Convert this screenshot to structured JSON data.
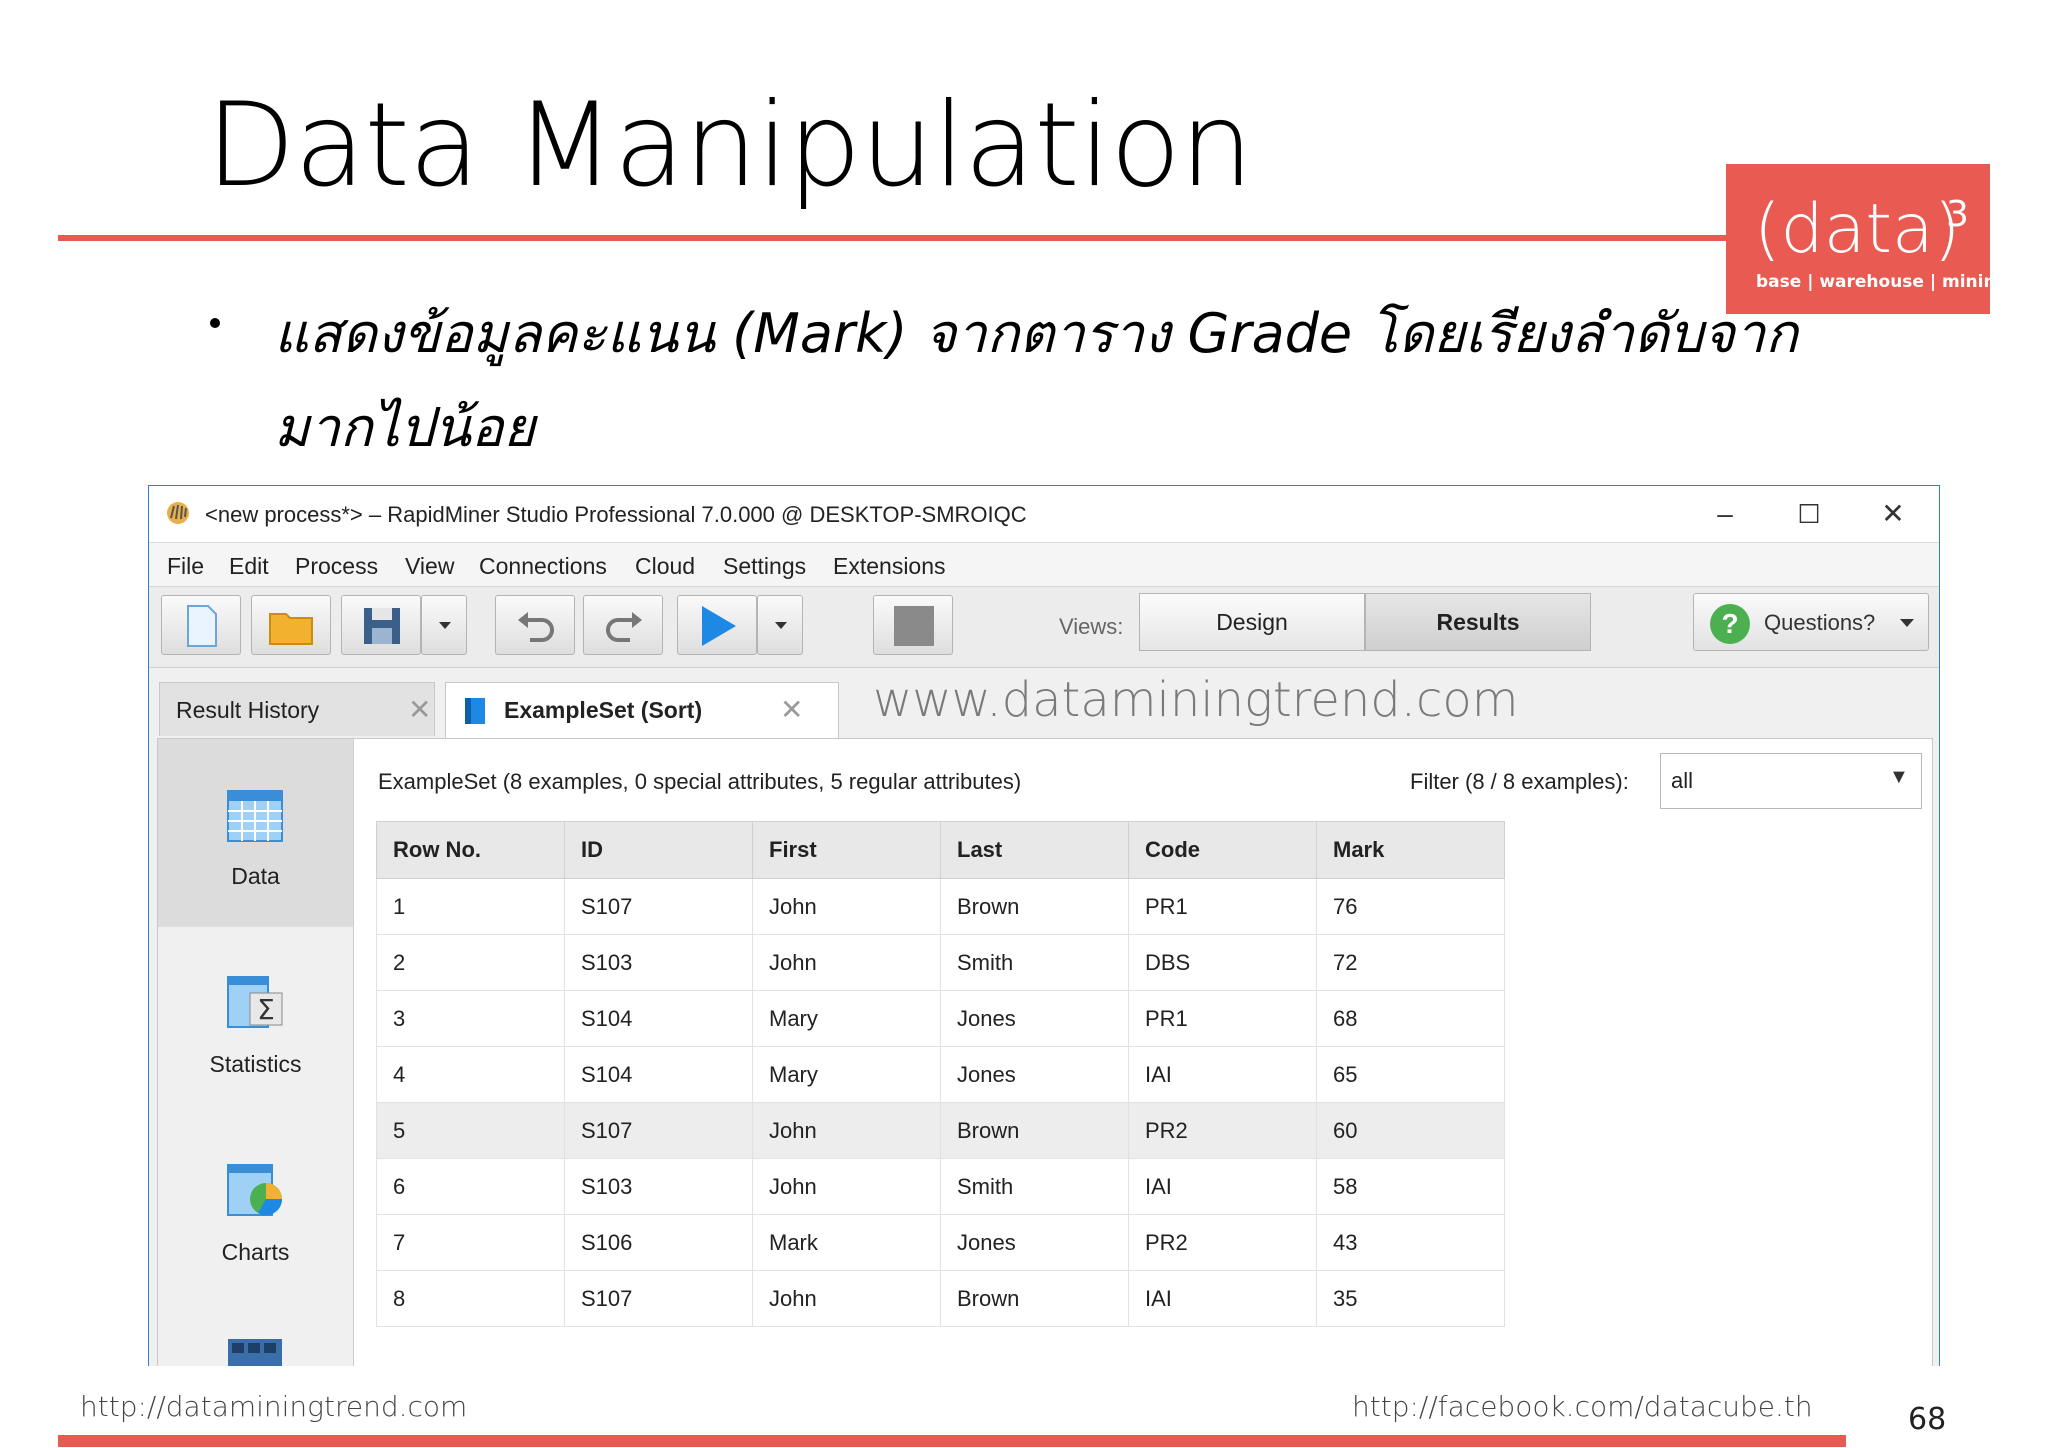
{
  "slide": {
    "title": "Data Manipulation",
    "bullet_line1": "แสดงข้อมูลคะแนน (Mark) จากตาราง Grade โดยเรียงลำดับจาก",
    "bullet_line2": "มากไปน้อย",
    "logo": {
      "main": "(data)",
      "sup": "3",
      "sub": "base | warehouse | mining"
    },
    "footer_left": "http://dataminingtrend.com",
    "footer_right": "http://facebook.com/datacube.th",
    "page_number": "68",
    "accent_color": "#e85a52"
  },
  "app": {
    "title": "<new process*> – RapidMiner Studio Professional 7.0.000 @ DESKTOP-SMROIQC",
    "window_controls": {
      "minimize": "–",
      "maximize": "☐",
      "close": "✕"
    },
    "menu": [
      "File",
      "Edit",
      "Process",
      "View",
      "Connections",
      "Cloud",
      "Settings",
      "Extensions"
    ],
    "toolbar": {
      "icons": [
        "new-file-icon",
        "open-folder-icon",
        "save-icon",
        "undo-icon",
        "redo-icon",
        "run-icon",
        "stop-icon"
      ],
      "views_label": "Views:",
      "view_design": "Design",
      "view_results": "Results",
      "questions": "Questions?"
    },
    "tabs": [
      {
        "label": "Result History",
        "close": "✕"
      },
      {
        "label": "ExampleSet (Sort)",
        "close": "✕"
      }
    ],
    "watermark": "www.dataminingtrend.com",
    "side_nav": [
      {
        "label": "Data",
        "icon": "data-table-icon"
      },
      {
        "label": "Statistics",
        "icon": "statistics-icon"
      },
      {
        "label": "Charts",
        "icon": "charts-icon"
      }
    ],
    "summary": "ExampleSet (8 examples, 0 special attributes, 5 regular attributes)",
    "filter_label": "Filter (8 / 8 examples):",
    "filter_value": "all",
    "table": {
      "headers": [
        "Row No.",
        "ID",
        "First",
        "Last",
        "Code",
        "Mark"
      ],
      "rows": [
        [
          "1",
          "S107",
          "John",
          "Brown",
          "PR1",
          "76"
        ],
        [
          "2",
          "S103",
          "John",
          "Smith",
          "DBS",
          "72"
        ],
        [
          "3",
          "S104",
          "Mary",
          "Jones",
          "PR1",
          "68"
        ],
        [
          "4",
          "S104",
          "Mary",
          "Jones",
          "IAI",
          "65"
        ],
        [
          "5",
          "S107",
          "John",
          "Brown",
          "PR2",
          "60"
        ],
        [
          "6",
          "S103",
          "John",
          "Smith",
          "IAI",
          "58"
        ],
        [
          "7",
          "S106",
          "Mark",
          "Jones",
          "PR2",
          "43"
        ],
        [
          "8",
          "S107",
          "John",
          "Brown",
          "IAI",
          "35"
        ]
      ],
      "highlighted_row": 5
    }
  }
}
